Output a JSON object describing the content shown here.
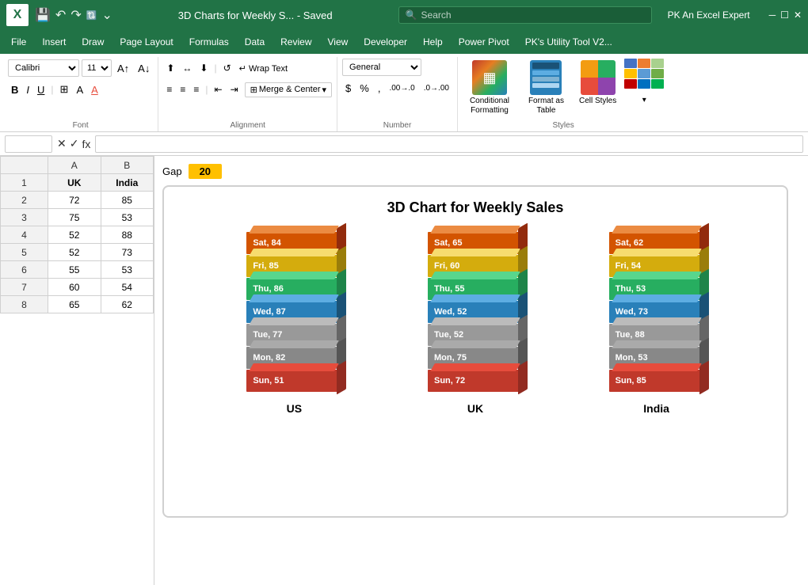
{
  "titlebar": {
    "logo": "X",
    "filename": "3D Charts for Weekly S... - Saved",
    "search_placeholder": "Search",
    "user": "PK An Excel Expert"
  },
  "menu": {
    "items": [
      "File",
      "Insert",
      "Draw",
      "Page Layout",
      "Formulas",
      "Data",
      "Review",
      "View",
      "Developer",
      "Help",
      "Power Pivot",
      "PK's Utility Tool V2..."
    ]
  },
  "ribbon": {
    "font_name": "Calibri",
    "font_size": "11",
    "wrap_text": "Wrap Text",
    "merge_center": "Merge & Center",
    "number_format": "General",
    "alignment_label": "Alignment",
    "font_label": "Font",
    "number_label": "Number",
    "styles_label": "Styles",
    "conditional_formatting": "Conditional Formatting",
    "format_as_table": "Format as Table",
    "cell_styles": "Cell Styles"
  },
  "formula_bar": {
    "cell_ref": "",
    "formula": ""
  },
  "spreadsheet": {
    "col_headers": [
      "",
      "UK",
      "India"
    ],
    "rows": [
      {
        "num": "",
        "uk": "UK",
        "india": "India"
      },
      {
        "num": "",
        "uk": "72",
        "india": "85"
      },
      {
        "num": "",
        "uk": "75",
        "india": "53"
      },
      {
        "num": "",
        "uk": "52",
        "india": "88"
      },
      {
        "num": "",
        "uk": "52",
        "india": "73"
      },
      {
        "num": "",
        "uk": "55",
        "india": "53"
      },
      {
        "num": "",
        "uk": "60",
        "india": "54"
      },
      {
        "num": "",
        "uk": "65",
        "india": "62"
      }
    ],
    "gap_label": "Gap",
    "gap_value": "20"
  },
  "chart": {
    "title": "3D Chart for Weekly Sales",
    "columns": [
      {
        "label": "US",
        "bars": [
          {
            "day": "Sat",
            "val": 84,
            "color": "orange"
          },
          {
            "day": "Fri",
            "val": 85,
            "color": "yellow"
          },
          {
            "day": "Thu",
            "val": 86,
            "color": "green"
          },
          {
            "day": "Wed",
            "val": 87,
            "color": "blue"
          },
          {
            "day": "Tue",
            "val": 77,
            "color": "gray"
          },
          {
            "day": "Mon",
            "val": 82,
            "color": "gray2"
          },
          {
            "day": "Sun",
            "val": 51,
            "color": "red"
          }
        ]
      },
      {
        "label": "UK",
        "bars": [
          {
            "day": "Sat",
            "val": 65,
            "color": "orange"
          },
          {
            "day": "Fri",
            "val": 60,
            "color": "yellow"
          },
          {
            "day": "Thu",
            "val": 55,
            "color": "green"
          },
          {
            "day": "Wed",
            "val": 52,
            "color": "blue"
          },
          {
            "day": "Tue",
            "val": 52,
            "color": "gray"
          },
          {
            "day": "Mon",
            "val": 75,
            "color": "gray2"
          },
          {
            "day": "Sun",
            "val": 72,
            "color": "red"
          }
        ]
      },
      {
        "label": "India",
        "bars": [
          {
            "day": "Sat",
            "val": 62,
            "color": "orange"
          },
          {
            "day": "Fri",
            "val": 54,
            "color": "yellow"
          },
          {
            "day": "Thu",
            "val": 53,
            "color": "green"
          },
          {
            "day": "Wed",
            "val": 73,
            "color": "blue"
          },
          {
            "day": "Tue",
            "val": 88,
            "color": "gray"
          },
          {
            "day": "Mon",
            "val": 53,
            "color": "gray2"
          },
          {
            "day": "Sun",
            "val": 85,
            "color": "red"
          }
        ]
      }
    ]
  }
}
